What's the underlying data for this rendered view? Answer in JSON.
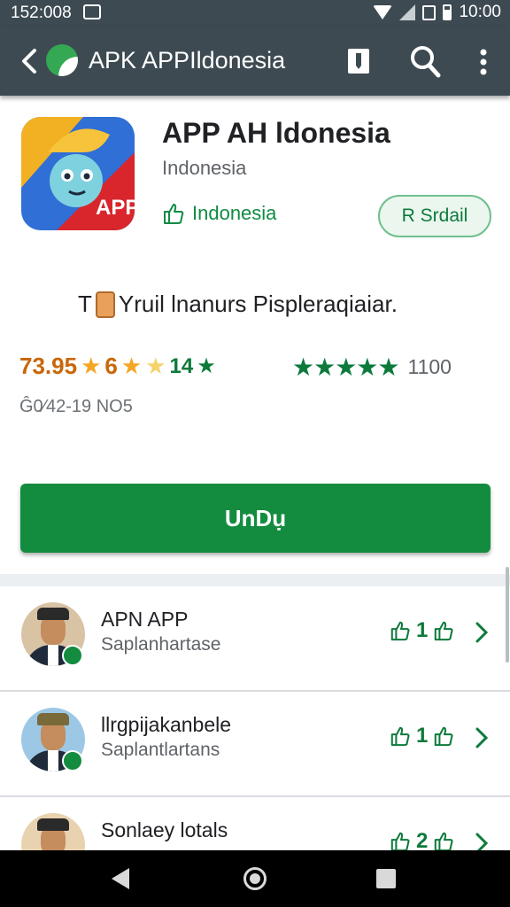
{
  "status_bar": {
    "time": "152:008",
    "right_time": "10:00"
  },
  "app_bar": {
    "title": "APK APPIldonesia"
  },
  "app": {
    "name": "APP AH ldonesia",
    "developer": "Indonesia",
    "category": "Indonesia",
    "chip_button": "R Srdail",
    "icon_badge": "APP"
  },
  "tagline": {
    "prefix": "T",
    "text": "Yruil lnanurs Pispleraqiaiar."
  },
  "rating": {
    "left_value": "73.95",
    "left_mid": "6",
    "left_count": "14",
    "right_stars": "★★★★★",
    "right_count": "1100"
  },
  "meta_line": "Ĝ0⁄42-19 NO5",
  "install_button": "UnDụ",
  "list_items": [
    {
      "title": "APN APP",
      "subtitle": "Saplanhartase",
      "count": "1"
    },
    {
      "title": "llrgpijakanbele",
      "subtitle": "Saplantlartans",
      "count": "1"
    },
    {
      "title": "Sonlaey lotals",
      "subtitle": "",
      "count": "2"
    }
  ],
  "colors": {
    "primary": "#148c3f",
    "app_bar": "#3d4a52",
    "accent_orange": "#c8670a"
  }
}
